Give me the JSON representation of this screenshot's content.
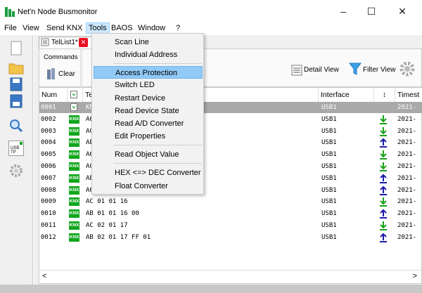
{
  "window": {
    "title": "Net'n Node Busmonitor",
    "controls": {
      "minimize": "–",
      "maximize": "☐",
      "close": "✕"
    }
  },
  "menubar": [
    {
      "label": "File"
    },
    {
      "label": "View"
    },
    {
      "label": "Send KNX"
    },
    {
      "label": "Tools"
    },
    {
      "label": "BAOS"
    },
    {
      "label": "Window"
    },
    {
      "label": "?"
    }
  ],
  "tab": {
    "label": "TelList1*",
    "close": "✕"
  },
  "ribbon": {
    "commands_group": "Commands",
    "clear_label": "Clear",
    "detail_view_label": "Detail View",
    "filter_view_label": "Filter View"
  },
  "tools_menu": [
    {
      "label": "Scan Line"
    },
    {
      "label": "Individual Address"
    },
    {
      "label": "Access Protection"
    },
    {
      "label": "Switch LED"
    },
    {
      "label": "Restart Device"
    },
    {
      "label": "Read Device State"
    },
    {
      "label": "Read A/D Converter"
    },
    {
      "label": "Edit Properties"
    },
    {
      "label": "Read Object Value"
    },
    {
      "label": "HEX <=> DEC Converter"
    },
    {
      "label": "Float Converter"
    }
  ],
  "leftbar": {
    "usb_tp_label": "USB TP"
  },
  "grid": {
    "columns": [
      "Num",
      "",
      "Te",
      "Interface",
      "↕",
      "Timest"
    ],
    "rows": [
      {
        "num": "0001",
        "tel": "KN",
        "iface": "USB1",
        "dir": "",
        "ts": "2021-"
      },
      {
        "num": "0002",
        "tel": "A6",
        "iface": "USB1",
        "dir": "down",
        "ts": "2021-"
      },
      {
        "num": "0003",
        "tel": "AC",
        "iface": "USB1",
        "dir": "down",
        "ts": "2021-"
      },
      {
        "num": "0004",
        "tel": "AE",
        "iface": "USB1",
        "dir": "up",
        "ts": "2021-"
      },
      {
        "num": "0005",
        "tel": "A6",
        "iface": "USB1",
        "dir": "down",
        "ts": "2021-"
      },
      {
        "num": "0006",
        "tel": "AC",
        "iface": "USB1",
        "dir": "down",
        "ts": "2021-"
      },
      {
        "num": "0007",
        "tel": "AE",
        "iface": "USB1",
        "dir": "up",
        "ts": "2021-"
      },
      {
        "num": "0008",
        "tel": "A6",
        "iface": "USB1",
        "dir": "up",
        "ts": "2021-"
      },
      {
        "num": "0009",
        "tel": "AC 01 01 16",
        "iface": "USB1",
        "dir": "down",
        "ts": "2021-"
      },
      {
        "num": "0010",
        "tel": "AB 01 01 16 00",
        "iface": "USB1",
        "dir": "up",
        "ts": "2021-"
      },
      {
        "num": "0011",
        "tel": "AC 02 01 17",
        "iface": "USB1",
        "dir": "down",
        "ts": "2021-"
      },
      {
        "num": "0012",
        "tel": "AB 02 01 17 FF 01",
        "iface": "USB1",
        "dir": "up",
        "ts": "2021-"
      }
    ],
    "knx_badge": "KNX"
  },
  "colors": {
    "selected_row": "#a9a9a9",
    "menu_highlight": "#91c9f7",
    "down_arrow": "#1aa01a",
    "up_arrow": "#1c1ca8",
    "knx_badge": "#11a61c"
  },
  "scroll": {
    "left": "<",
    "right": ">"
  }
}
